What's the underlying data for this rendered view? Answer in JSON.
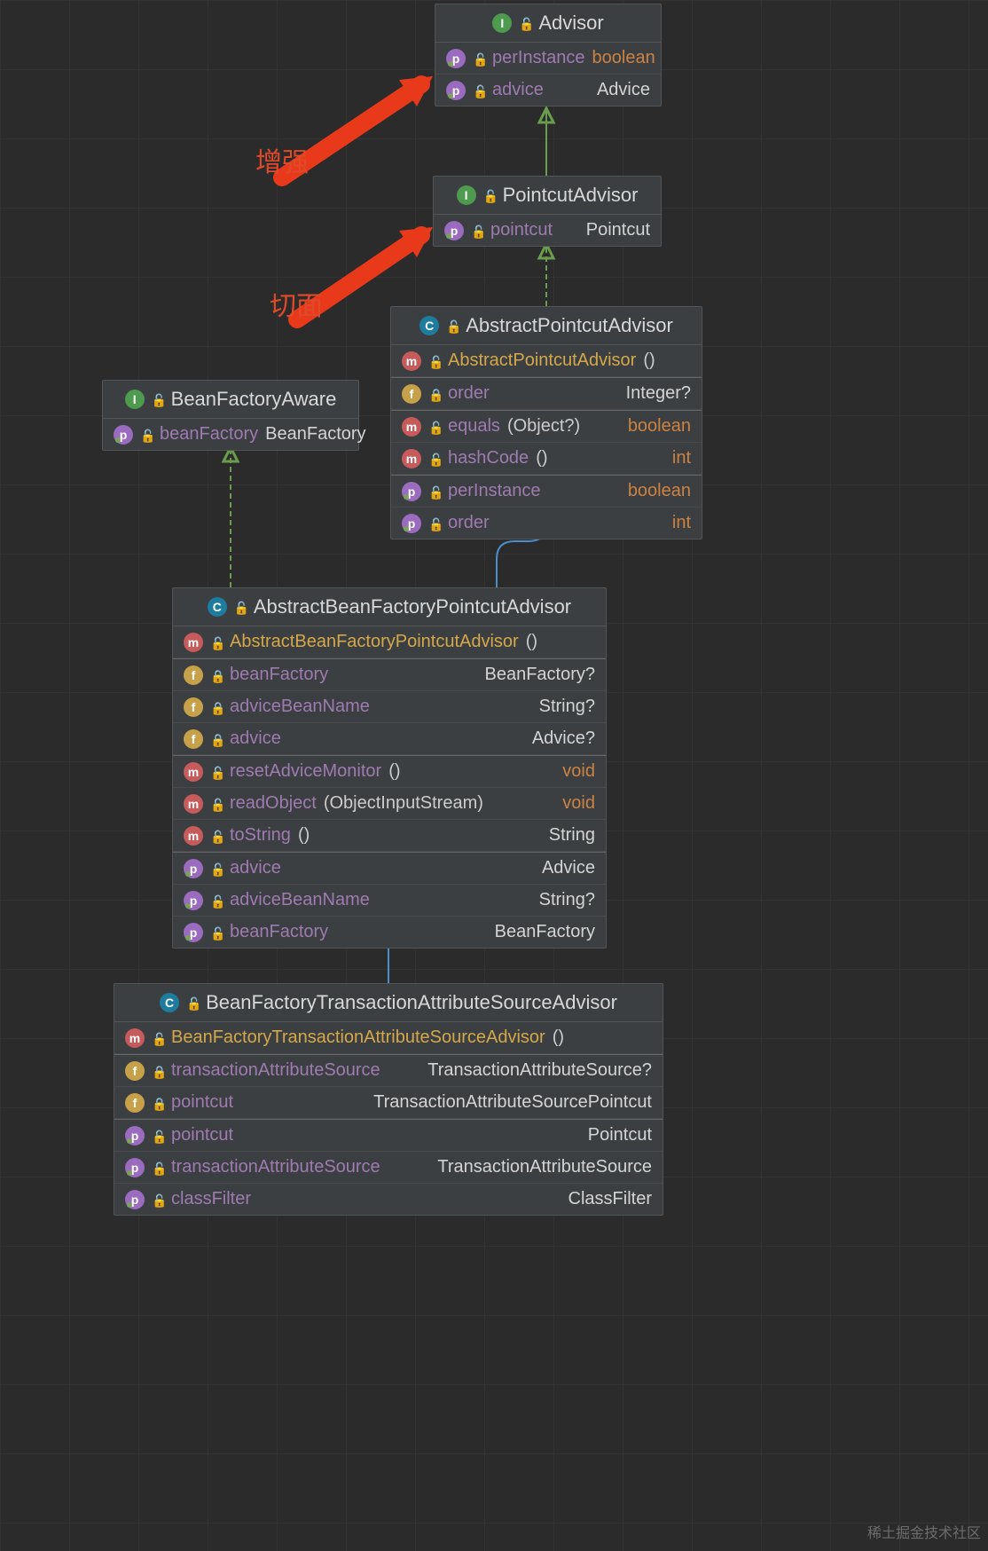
{
  "annotations": {
    "enhance": "增强",
    "aspect": "切面"
  },
  "watermark": "稀土掘金技术社区",
  "classes": {
    "advisor": {
      "title": "Advisor",
      "members": [
        {
          "icon": "p",
          "dot": true,
          "lock": "unlock",
          "name": "perInstance",
          "type": "boolean",
          "kw": true
        },
        {
          "icon": "p",
          "dot": true,
          "lock": "unlock",
          "name": "advice",
          "type": "Advice"
        }
      ]
    },
    "pointcutAdvisor": {
      "title": "PointcutAdvisor",
      "members": [
        {
          "icon": "p",
          "dot": true,
          "lock": "unlock",
          "name": "pointcut",
          "type": "Pointcut"
        }
      ]
    },
    "beanFactoryAware": {
      "title": "BeanFactoryAware",
      "members": [
        {
          "icon": "p",
          "dot": true,
          "lock": "unlock",
          "name": "beanFactory",
          "type": "BeanFactory"
        }
      ]
    },
    "abstractPointcutAdvisor": {
      "title": "AbstractPointcutAdvisor",
      "members": [
        {
          "icon": "m",
          "lock": "unlock",
          "ctor": true,
          "name": "AbstractPointcutAdvisor",
          "paren": "()"
        },
        {
          "icon": "f",
          "lock": "lock",
          "name": "order",
          "type": "Integer?",
          "sep": true
        },
        {
          "icon": "m",
          "lock": "unlock",
          "name": "equals",
          "paren": "(Object?)",
          "type": "boolean",
          "kw": true,
          "sep": true
        },
        {
          "icon": "m",
          "lock": "unlock",
          "name": "hashCode",
          "paren": "()",
          "type": "int",
          "kw": true
        },
        {
          "icon": "p",
          "dot": true,
          "lock": "unlock",
          "name": "perInstance",
          "type": "boolean",
          "kw": true,
          "sep": true
        },
        {
          "icon": "p",
          "dot": true,
          "lock": "unlock",
          "name": "order",
          "type": "int",
          "kw": true
        }
      ]
    },
    "abstractBeanFactoryPointcutAdvisor": {
      "title": "AbstractBeanFactoryPointcutAdvisor",
      "members": [
        {
          "icon": "m",
          "lock": "unlock",
          "ctor": true,
          "name": "AbstractBeanFactoryPointcutAdvisor",
          "paren": "()"
        },
        {
          "icon": "f",
          "lock": "lock",
          "name": "beanFactory",
          "type": "BeanFactory?",
          "sep": true
        },
        {
          "icon": "f",
          "lock": "lock",
          "name": "adviceBeanName",
          "type": "String?"
        },
        {
          "icon": "f",
          "lock": "lock",
          "name": "advice",
          "type": "Advice?"
        },
        {
          "icon": "m",
          "lock": "unlock",
          "name": "resetAdviceMonitor",
          "paren": "()",
          "type": "void",
          "kw": true,
          "sep": true
        },
        {
          "icon": "m",
          "lock": "unlock",
          "name": "readObject",
          "paren": "(ObjectInputStream)",
          "type": "void",
          "kw": true
        },
        {
          "icon": "m",
          "lock": "unlock",
          "name": "toString",
          "paren": "()",
          "type": "String"
        },
        {
          "icon": "p",
          "dot": true,
          "lock": "unlock",
          "name": "advice",
          "type": "Advice",
          "sep": true
        },
        {
          "icon": "p",
          "dot": true,
          "lock": "unlock",
          "name": "adviceBeanName",
          "type": "String?"
        },
        {
          "icon": "p",
          "dot": true,
          "lock": "unlock",
          "name": "beanFactory",
          "type": "BeanFactory"
        }
      ]
    },
    "beanFactoryTransactionAttributeSourceAdvisor": {
      "title": "BeanFactoryTransactionAttributeSourceAdvisor",
      "members": [
        {
          "icon": "m",
          "lock": "unlock",
          "ctor": true,
          "name": "BeanFactoryTransactionAttributeSourceAdvisor",
          "paren": "()"
        },
        {
          "icon": "f",
          "lock": "lock",
          "name": "transactionAttributeSource",
          "type": "TransactionAttributeSource?",
          "sep": true
        },
        {
          "icon": "f",
          "lock": "lock",
          "name": "pointcut",
          "type": "TransactionAttributeSourcePointcut"
        },
        {
          "icon": "p",
          "dot": true,
          "lock": "unlock",
          "name": "pointcut",
          "type": "Pointcut",
          "sep": true
        },
        {
          "icon": "p",
          "dot": true,
          "lock": "unlock",
          "name": "transactionAttributeSource",
          "type": "TransactionAttributeSource"
        },
        {
          "icon": "p",
          "dot": true,
          "lock": "unlock",
          "name": "classFilter",
          "type": "ClassFilter"
        }
      ]
    }
  }
}
